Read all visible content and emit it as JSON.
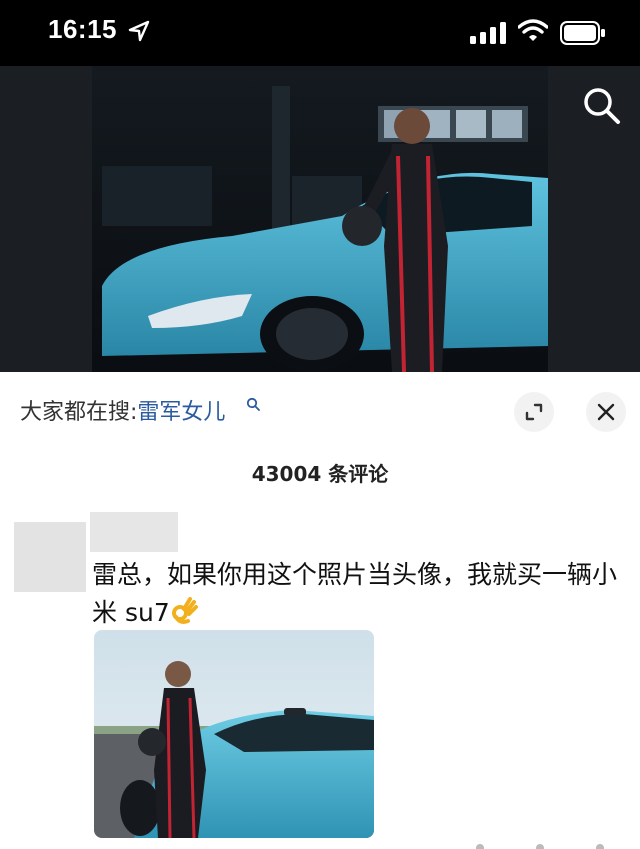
{
  "status_bar": {
    "time": "16:15",
    "icons": [
      "location-arrow-icon",
      "cellular-signal-icon",
      "wifi-icon",
      "battery-icon"
    ]
  },
  "video": {
    "search_icon": "search-icon",
    "description_colors": {
      "car": "#4bb3d1",
      "background": "#0f1318"
    }
  },
  "panel": {
    "search_prefix": "大家都在搜:",
    "search_term": "雷军女儿",
    "comment_count": "43004 条评论"
  },
  "comment": {
    "text": "雷总，如果你用这个照片当头像，我就买一辆小米 su7",
    "emoji": "ok-hand-emoji"
  },
  "colors": {
    "accent_link": "#2b5b9f",
    "status_bar": "#000000",
    "panel_bg": "#ffffff"
  }
}
